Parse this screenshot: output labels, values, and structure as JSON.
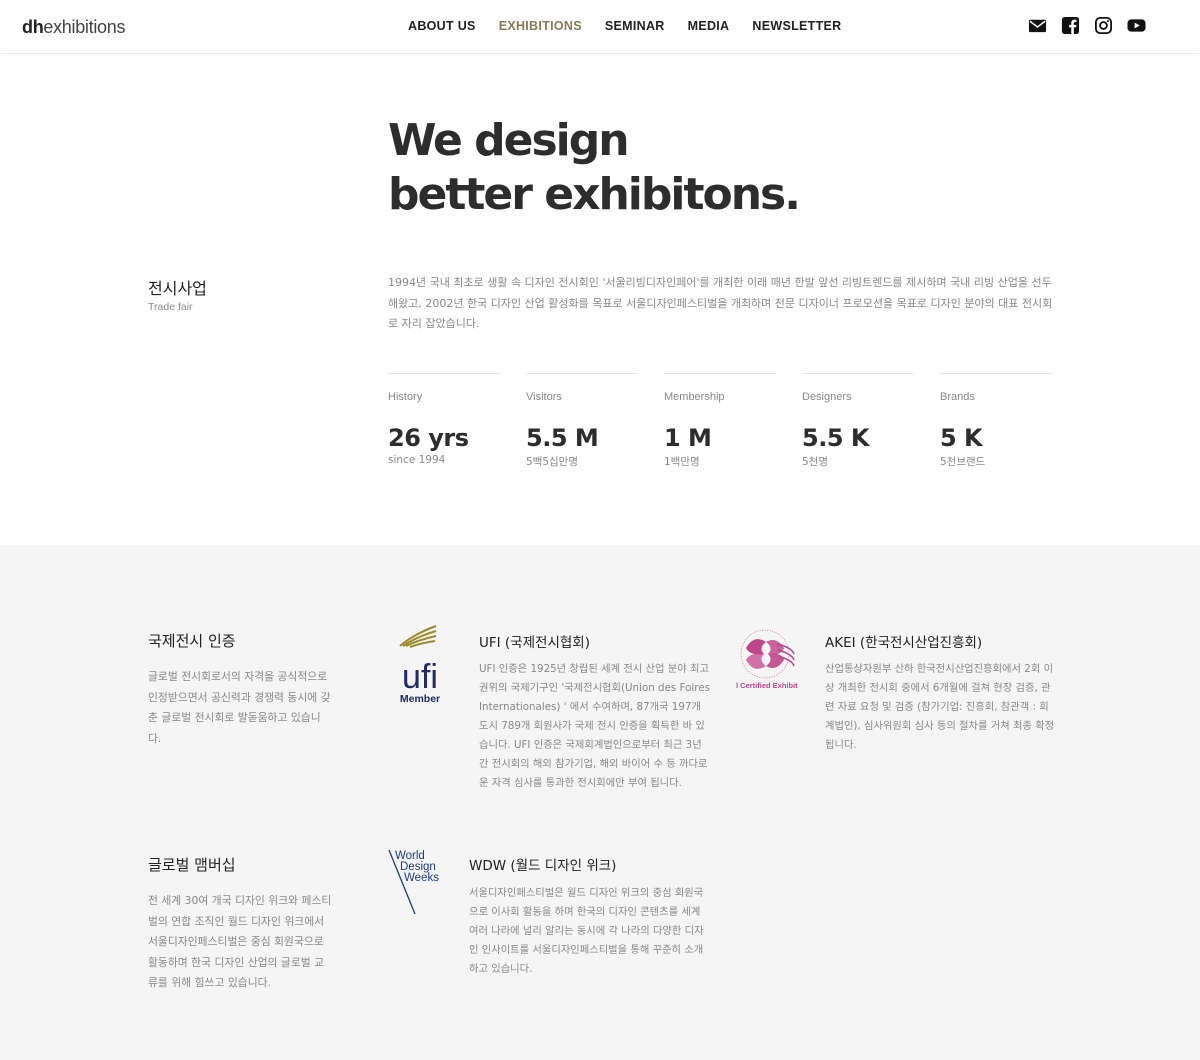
{
  "header": {
    "logo_bold": "dh",
    "logo_rest": "exhibitions",
    "nav": [
      {
        "label": "ABOUT US",
        "active": false
      },
      {
        "label": "EXHIBITIONS",
        "active": true
      },
      {
        "label": "SEMINAR",
        "active": false
      },
      {
        "label": "MEDIA",
        "active": false
      },
      {
        "label": "NEWSLETTER",
        "active": false
      }
    ],
    "social_icons": [
      "envelope-icon",
      "facebook-icon",
      "instagram-icon",
      "youtube-icon"
    ],
    "active_color": "#8b7a5a"
  },
  "hero": {
    "line1": "We design",
    "line2": "better exhibitons."
  },
  "trade_fair": {
    "title": "전시사업",
    "subtitle": "Trade fair",
    "description": "1994년 국내 최초로 생활 속 디자인 전시회인 '서울리빙디자인페어'를 개최한 이래 매년 한발 앞선 리빙트렌드를 제시하며 국내 리빙 산업을 선두 해왔고, 2002년 한국 디자인 산업 활성화를 목표로 서울디자인페스티벌을 개최하며 전문 디자이너 프로모션을 목표로 디자인 분야의 대표 전시회로 자리 잡았습니다."
  },
  "stats": [
    {
      "label": "History",
      "value": "26 yrs",
      "sub": "since 1994"
    },
    {
      "label": "Visitors",
      "value": "5.5 M",
      "sub": "5백5십만명"
    },
    {
      "label": "Membership",
      "value": "1 M",
      "sub": "1백만명"
    },
    {
      "label": "Designers",
      "value": "5.5 K",
      "sub": "5천명"
    },
    {
      "label": "Brands",
      "value": "5 K",
      "sub": "5천브랜드"
    }
  ],
  "certification": {
    "title": "국제전시 인증",
    "description": "글로벌 전시회로서의 자격을 공식적으로 인정받으면서 공신력과 경쟁력 동시에 갖춘 글로벌 전시회로 발돋움하고 있습니다.",
    "ufi": {
      "logo_text": "ufi",
      "logo_sub": "Member",
      "title": "UFI (국제전시협회)",
      "description": "UFI 인증은 1925년 창립된 세계 전시 산업 분야 최고 권위의 국제기구인 '국제전시협회(Union des Foires Internationales) ' 에서 수여하며, 87개국 197개 도시 789개 회원사가 국제 전시 인증을 획득한 바 있습니다. UFI 인증은 국제회계법인으로부터 최근 3년간 전시회의 해외 참가기업, 해외 바이어 수 등 까다로운 자격 심사를 통과한 전시회에만 부여 됩니다."
    },
    "akei": {
      "logo_text": "Int'l Certified Exhibition",
      "title": "AKEI (한국전시산업진흥회)",
      "description": "산업통상자원부 산하 한국전시산업진흥회에서 2회 이상 개최한 전시회 중에서 6개월에 걸쳐 현장 검증, 관련 자료 요청 및 검증 (참가기업: 진흥회, 참관객 : 회계법인), 심사위원회 심사 등의 절차를 거쳐 최종 확정됩니다."
    }
  },
  "membership": {
    "title": "글로벌 맴버십",
    "description": "전 세계 30여 개국 디자인 위크와 페스티벌의 연합 조직인 월드 디자인 위크에서 서울디자인페스티벌은 중심 회원국으로 활동하며 한국 디자인 산업의 글로벌 교류를 위해 힘쓰고 있습니다.",
    "wdw": {
      "logo_line1": "World",
      "logo_line2": "Design",
      "logo_line3": "Weeks",
      "title": "WDW (월드 디자인 위크)",
      "description": "서울디자인페스티벌은 월드 디자인 위크의 중심 회원국으로 이사회 활동을 하며 한국의 디자인 콘텐츠를 세계 여러 나라에 널리 알리는 동시에 각 나라의 다양한 디자인 인사이트를 서울디자인페스티벌을 통해 꾸준히 소개하고 있습니다."
    }
  }
}
